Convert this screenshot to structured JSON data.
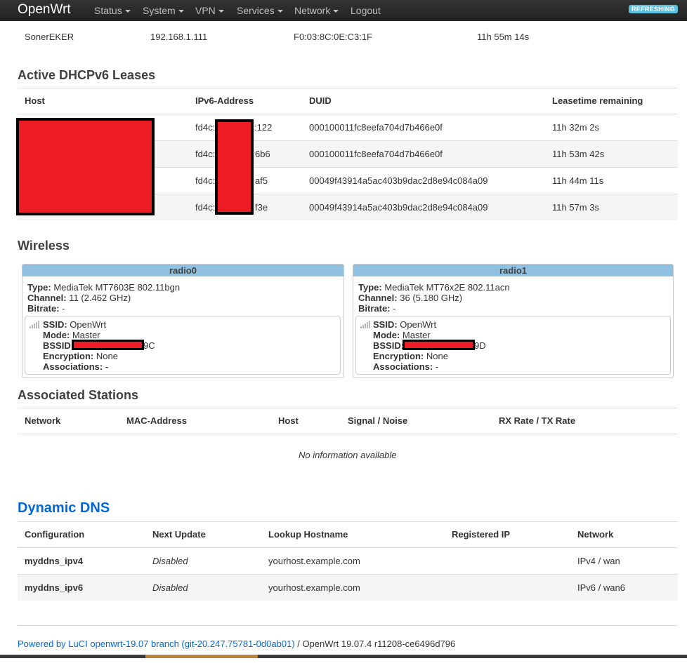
{
  "nav": {
    "brand": "OpenWrt",
    "items": [
      {
        "label": "Status",
        "dropdown": true
      },
      {
        "label": "System",
        "dropdown": true
      },
      {
        "label": "VPN",
        "dropdown": true
      },
      {
        "label": "Services",
        "dropdown": true
      },
      {
        "label": "Network",
        "dropdown": true
      },
      {
        "label": "Logout",
        "dropdown": false
      }
    ],
    "badge": "REFRESHING"
  },
  "dhcp_row": {
    "host": "SonerEKER",
    "ip": "192.168.1.111",
    "mac": "F0:03:8C:0E:C3:1F",
    "lease": "11h 55m 14s"
  },
  "dhcpv6": {
    "title": "Active DHCPv6 Leases",
    "headers": [
      "Host",
      "IPv6-Address",
      "DUID",
      "Leasetime remaining"
    ],
    "rows": [
      {
        "ipv6_start": "fd4c:",
        "ipv6_end": ":122",
        "duid": "000100011fc8eefa704d7b466e0f",
        "lease": "11h 32m 2s"
      },
      {
        "ipv6_start": "fd4c:",
        "ipv6_end": "6b6",
        "duid": "000100011fc8eefa704d7b466e0f",
        "lease": "11h 53m 42s"
      },
      {
        "ipv6_start": "fd4c:",
        "ipv6_end": "af5",
        "duid": "00049f43914a5ac403b9dac2d8e94c084a09",
        "lease": "11h 44m 11s"
      },
      {
        "ipv6_start": "fd4c:",
        "ipv6_end": "f3e",
        "duid": "00049f43914a5ac403b9dac2d8e94c084a09",
        "lease": "11h 57m 3s"
      }
    ]
  },
  "wireless": {
    "title": "Wireless",
    "labels": {
      "type": "Type:",
      "channel": "Channel:",
      "bitrate": "Bitrate:",
      "ssid": "SSID:",
      "mode": "Mode:",
      "bssid": "BSSID:",
      "encryption": "Encryption:",
      "associations": "Associations:"
    },
    "radios": [
      {
        "name": "radio0",
        "type": "MediaTek MT7603E 802.11bgn",
        "channel": "11 (2.462 GHz)",
        "bitrate": "-",
        "ssid": "OpenWrt",
        "mode": "Master",
        "bssid_end": "9C",
        "encryption": "None",
        "associations": "-"
      },
      {
        "name": "radio1",
        "type": "MediaTek MT76x2E 802.11acn",
        "channel": "36 (5.180 GHz)",
        "bitrate": "-",
        "ssid": "OpenWrt",
        "mode": "Master",
        "bssid_end": "9D",
        "encryption": "None",
        "associations": "-"
      }
    ]
  },
  "stations": {
    "title": "Associated Stations",
    "headers": [
      "Network",
      "MAC-Address",
      "Host",
      "Signal / Noise",
      "RX Rate / TX Rate"
    ],
    "empty": "No information available"
  },
  "ddns": {
    "title": "Dynamic DNS",
    "headers": [
      "Configuration",
      "Next Update",
      "Lookup Hostname",
      "Registered IP",
      "Network"
    ],
    "rows": [
      {
        "config": "myddns_ipv4",
        "next": "Disabled",
        "hostname": "yourhost.example.com",
        "ip": "",
        "network": "IPv4 / wan"
      },
      {
        "config": "myddns_ipv6",
        "next": "Disabled",
        "hostname": "yourhost.example.com",
        "ip": "",
        "network": "IPv6 / wan6"
      }
    ]
  },
  "footer": {
    "link": "Powered by LuCI openwrt-19.07 branch (git-20.247.75781-0d0ab01)",
    "rest": " / OpenWrt 19.07.4 r11208-ce6496d796"
  },
  "colors": {
    "accent": "#0069d6",
    "radio_header": "#90c0e0",
    "badge": "#5bc0de",
    "redaction": "#ed1c24"
  }
}
